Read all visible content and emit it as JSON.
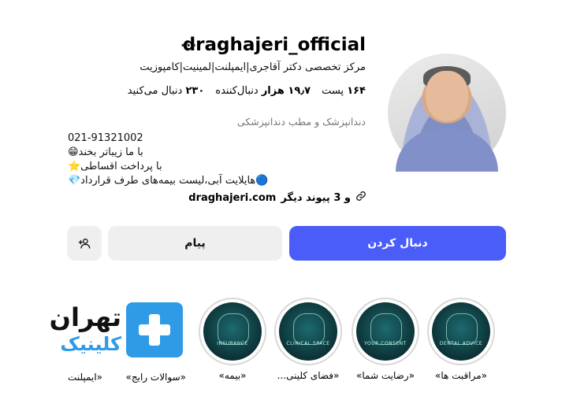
{
  "profile": {
    "username": "draghajeri_official",
    "more": "...",
    "bio_title": "مرکز تخصصی دکتر آقاجری|ایمپلنت|لمینیت|کامپوزیت",
    "stats": {
      "posts": "۱۶۴",
      "posts_label": "پست",
      "followers": "۱۹٫۷ هزار",
      "followers_label": "دنبال‌کننده",
      "following": "۲۳۰",
      "following_label": "دنبال می‌کنید"
    },
    "category": "دندانپزشک و مطب دندانپزشکی",
    "bio_lines": [
      "021-91321002",
      "با ما زیباتر بخند😁",
      "با پرداخت اقساطی⭐",
      "🔵هایلایت آبی،لیست بیمه‌های طرف قرارداد💎"
    ],
    "link_url": "draghajeri.com",
    "link_more": "و 3 پیوند دیگر"
  },
  "actions": {
    "follow": "دنبال کردن",
    "message": "پیام",
    "suggest_icon": "add-person-icon"
  },
  "highlights": [
    {
      "label": "«مراقبت ها»",
      "cover_text": "DENTAL ADVICE"
    },
    {
      "label": "«رضایت شما»",
      "cover_text": "YOUR CONSENT"
    },
    {
      "label": "«فضای کلینی...",
      "cover_text": "CLINICAL SPACE"
    },
    {
      "label": "«بیمه»",
      "cover_text": "INSURANCE"
    },
    {
      "label": "«سوالات رایج»",
      "cover_text": ""
    },
    {
      "label": "«ایمپلنت",
      "cover_text": ""
    }
  ],
  "clinic_logo": {
    "line1": "تهران",
    "line2": "کلینیک",
    "color": "#2f9ae6"
  },
  "colors": {
    "follow_button": "#4a5df9",
    "secondary_button": "#efeff0"
  }
}
